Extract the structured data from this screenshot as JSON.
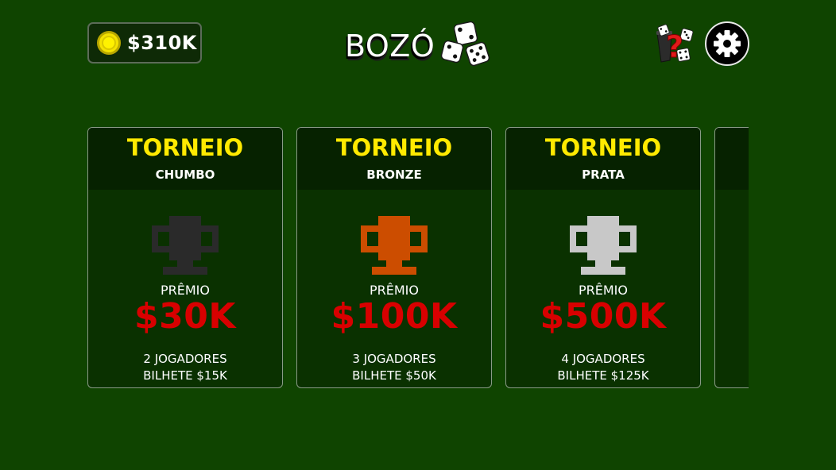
{
  "header": {
    "coins": "$310K",
    "logo_text": "BOZÓ",
    "logo_icon": "dice-icon",
    "help_icon": "help-dice-icon",
    "settings_icon": "gear-icon"
  },
  "tournaments": [
    {
      "title": "TORNEIO",
      "tier": "CHUMBO",
      "trophy_color": "#2a2a2a",
      "prize_label": "PRÊMIO",
      "prize": "$30K",
      "players": "2 JOGADORES",
      "ticket": "BILHETE $15K"
    },
    {
      "title": "TORNEIO",
      "tier": "BRONZE",
      "trophy_color": "#cc4d00",
      "prize_label": "PRÊMIO",
      "prize": "$100K",
      "players": "3 JOGADORES",
      "ticket": "BILHETE $50K"
    },
    {
      "title": "TORNEIO",
      "tier": "PRATA",
      "trophy_color": "#c8c8c8",
      "prize_label": "PRÊMIO",
      "prize": "$500K",
      "players": "4 JOGADORES",
      "ticket": "BILHETE $125K"
    }
  ],
  "colors": {
    "background": "#0f4400",
    "card_title": "#ffea00",
    "prize": "#d80000"
  }
}
